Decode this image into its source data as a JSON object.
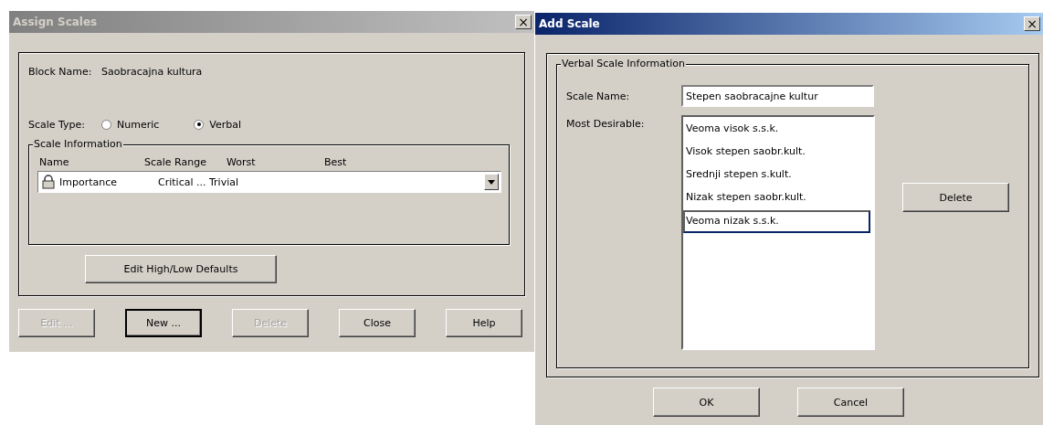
{
  "assign_scales": {
    "title": "Assign Scales",
    "active": false,
    "close": "×",
    "block_name": {
      "label": "Block Name:",
      "value": "Saobracajna kultura"
    },
    "scale_type": {
      "label": "Scale Type:",
      "options": [
        {
          "label": "Numeric",
          "selected": false
        },
        {
          "label": "Verbal",
          "selected": true
        }
      ]
    },
    "scale_information": {
      "legend": "Scale Information",
      "columns": [
        "Name",
        "Scale Range",
        "Worst",
        "Best"
      ],
      "row": {
        "name": "Importance",
        "range": "Critical ... Trivial",
        "locked": true
      }
    },
    "defaults_button": "Edit High/Low Defaults",
    "buttons": [
      {
        "label": "Edit ...",
        "disabled": true,
        "default": false
      },
      {
        "label": "New ...",
        "disabled": false,
        "default": true
      },
      {
        "label": "Delete",
        "disabled": true,
        "default": false
      },
      {
        "label": "Close",
        "disabled": false,
        "default": false
      },
      {
        "label": "Help",
        "disabled": false,
        "default": false
      }
    ]
  },
  "add_scale": {
    "title": "Add Scale",
    "active": true,
    "close": "×",
    "legend": "Verbal Scale Information",
    "scale_name": {
      "label": "Scale Name:",
      "value": "Stepen saobracajne kultur"
    },
    "most_desirable": {
      "label": "Most Desirable:",
      "items": [
        {
          "text": "Veoma visok s.s.k.",
          "selected": false
        },
        {
          "text": "Visok stepen saobr.kult.",
          "selected": false
        },
        {
          "text": "Srednji stepen s.kult.",
          "selected": false
        },
        {
          "text": "Nizak stepen saobr.kult.",
          "selected": false
        },
        {
          "text": "Veoma nizak s.s.k.",
          "selected": true
        }
      ]
    },
    "delete_button": "Delete",
    "buttons": [
      {
        "label": "OK"
      },
      {
        "label": "Cancel"
      }
    ]
  }
}
